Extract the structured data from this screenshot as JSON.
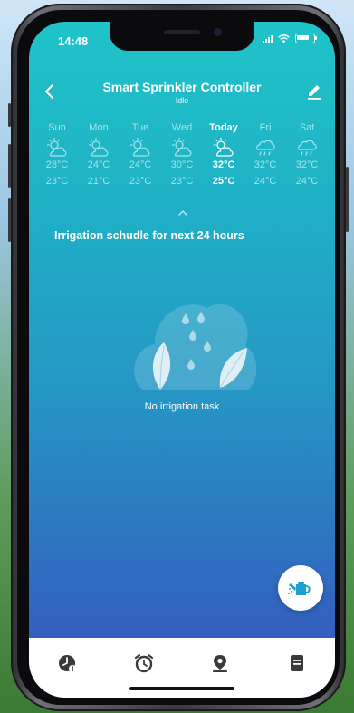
{
  "status_bar": {
    "time": "14:48"
  },
  "header": {
    "title": "Smart Sprinkler Controller",
    "subtitle": "Idle"
  },
  "weather": [
    {
      "day": "Sun",
      "high": "28°C",
      "low": "23°C",
      "icon": "partly-cloudy-icon",
      "today": false
    },
    {
      "day": "Mon",
      "high": "24°C",
      "low": "21°C",
      "icon": "partly-cloudy-icon",
      "today": false
    },
    {
      "day": "Tue",
      "high": "24°C",
      "low": "23°C",
      "icon": "partly-cloudy-icon",
      "today": false
    },
    {
      "day": "Wed",
      "high": "30°C",
      "low": "23°C",
      "icon": "partly-cloudy-icon",
      "today": false
    },
    {
      "day": "Today",
      "high": "32°C",
      "low": "25°C",
      "icon": "partly-cloudy-icon",
      "today": true
    },
    {
      "day": "Fri",
      "high": "32°C",
      "low": "24°C",
      "icon": "rain-icon",
      "today": false
    },
    {
      "day": "Sat",
      "high": "32°C",
      "low": "24°C",
      "icon": "rain-icon",
      "today": false
    }
  ],
  "schedule": {
    "title": "Irrigation schudle for next 24 hours",
    "empty_text": "No irrigation task"
  },
  "fab": {
    "icon": "watering-can-icon"
  },
  "bottom_nav": [
    {
      "icon": "clock-icon"
    },
    {
      "icon": "alarm-clock-icon"
    },
    {
      "icon": "location-pin-icon"
    },
    {
      "icon": "document-icon"
    }
  ],
  "colors": {
    "gradient_top": "#1fc3c8",
    "gradient_bottom": "#3552bb",
    "fab_icon": "#1f9fd0",
    "nav_icon": "#3a3a3a"
  }
}
